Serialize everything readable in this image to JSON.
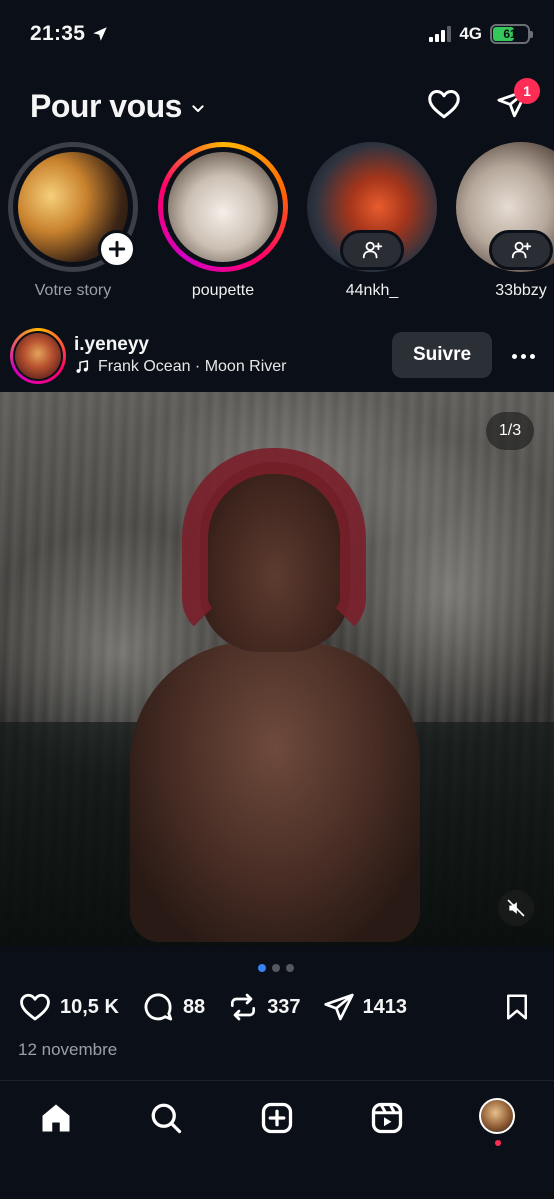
{
  "status": {
    "time": "21:35",
    "network": "4G",
    "battery": "61"
  },
  "header": {
    "title": "Pour vous",
    "notifications": "1"
  },
  "stories": [
    {
      "name": "Votre story",
      "type": "self"
    },
    {
      "name": "poupette",
      "type": "unseen"
    },
    {
      "name": "44nkh_",
      "type": "suggested"
    },
    {
      "name": "33bbzy",
      "type": "suggested"
    }
  ],
  "post": {
    "username": "i.yeneyy",
    "music": "Frank Ocean · Moon River",
    "follow_label": "Suivre",
    "counter": "1/3",
    "likes": "10,5 K",
    "comments": "88",
    "reposts": "337",
    "shares": "1413",
    "date": "12 novembre"
  },
  "carousel": {
    "count": 3,
    "active": 1
  },
  "colors": {
    "background": "#0b0f17",
    "accent": "#3b82f6",
    "badge": "#ff2d55",
    "battery": "#34c759"
  },
  "icons": [
    "location-arrow-icon",
    "heart-icon",
    "send-icon",
    "plus-icon",
    "add-user-icon",
    "music-note-icon",
    "more-icon",
    "mute-icon",
    "comment-icon",
    "repost-icon",
    "bookmark-icon",
    "home-icon",
    "search-icon",
    "create-icon",
    "reels-icon"
  ]
}
